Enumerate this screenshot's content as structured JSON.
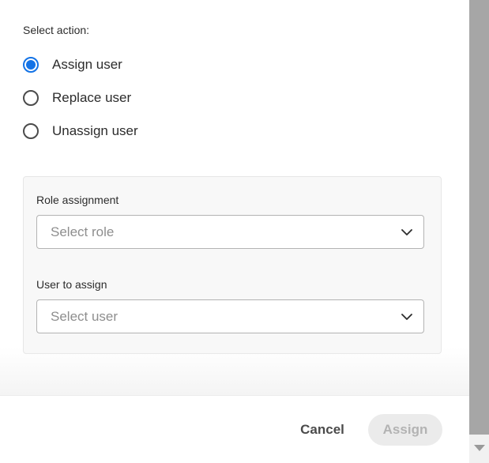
{
  "action_section": {
    "label": "Select action:",
    "options": [
      {
        "label": "Assign user",
        "checked": true
      },
      {
        "label": "Replace user",
        "checked": false
      },
      {
        "label": "Unassign user",
        "checked": false
      }
    ]
  },
  "panel": {
    "role": {
      "label": "Role assignment",
      "placeholder": "Select role",
      "icon": "chevron-down-icon"
    },
    "user": {
      "label": "User to assign",
      "placeholder": "Select user",
      "icon": "chevron-down-icon"
    }
  },
  "footer": {
    "cancel_label": "Cancel",
    "assign_label": "Assign"
  },
  "colors": {
    "accent": "#1473e6",
    "text": "#2c2c2c",
    "placeholder": "#8e8e8e",
    "disabled_text": "#b3b3b3",
    "disabled_bg": "#ebebeb"
  }
}
